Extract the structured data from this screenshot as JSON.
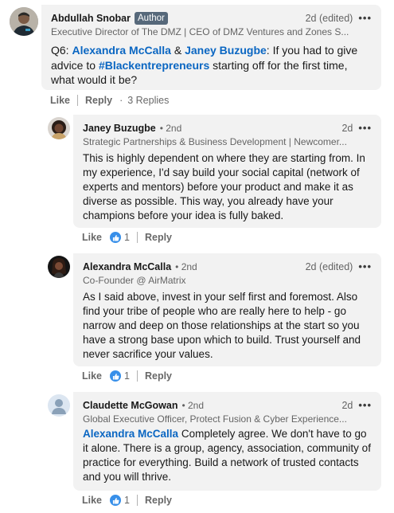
{
  "comments": [
    {
      "name": "Abdullah Snobar",
      "badge": "Author",
      "headline": "Executive Director of The DMZ | CEO of DMZ Ventures and Zones S...",
      "time": "2d (edited)",
      "body": {
        "prefix": "Q6: ",
        "mention1": "Alexandra McCalla",
        "amp": " & ",
        "mention2": "Janey Buzugbe",
        "text1": ": If you had to give advice to ",
        "hashtag": "#Blackentrepreneurs",
        "text2": " starting off for the first time, what would it be?"
      },
      "like_label": "Like",
      "reply_label": "Reply",
      "replies_label": "3 Replies"
    },
    {
      "name": "Janey Buzugbe",
      "degree": "• 2nd",
      "headline": "Strategic Partnerships & Business Development | Newcomer...",
      "time": "2d",
      "body": "This is highly dependent on where they are starting from. In my experience, I'd say build your social capital (network of experts and mentors) before your product and make it as diverse as possible. This way, you already have your champions before your idea is fully baked.",
      "like_label": "Like",
      "reaction_count": "1",
      "reply_label": "Reply"
    },
    {
      "name": "Alexandra McCalla",
      "degree": "• 2nd",
      "headline": "Co-Founder @ AirMatrix",
      "time": "2d (edited)",
      "body": "As I said above, invest in your self first and foremost. Also find your tribe of people who are really here to help - go narrow and deep on those relationships at the start so you have a strong base upon which to build. Trust yourself and never sacrifice your values.",
      "like_label": "Like",
      "reaction_count": "1",
      "reply_label": "Reply"
    },
    {
      "name": "Claudette McGowan",
      "degree": "• 2nd",
      "headline": "Global Executive Officer, Protect Fusion & Cyber Experience...",
      "time": "2d",
      "body": {
        "mention": "Alexandra McCalla",
        "text": " Completely agree. We don't have to go it alone. There is a group, agency, association, community of practice for everything. Build a network of trusted contacts and you will thrive."
      },
      "like_label": "Like",
      "reaction_count": "1",
      "reply_label": "Reply"
    }
  ],
  "colors": {
    "link": "#0a66c2",
    "bubble": "#f2f2f2",
    "badge": "#56687a",
    "like_icon": "#378fe9"
  },
  "icons": [
    "more-options-icon",
    "like-reaction-icon",
    "person-placeholder-icon"
  ]
}
